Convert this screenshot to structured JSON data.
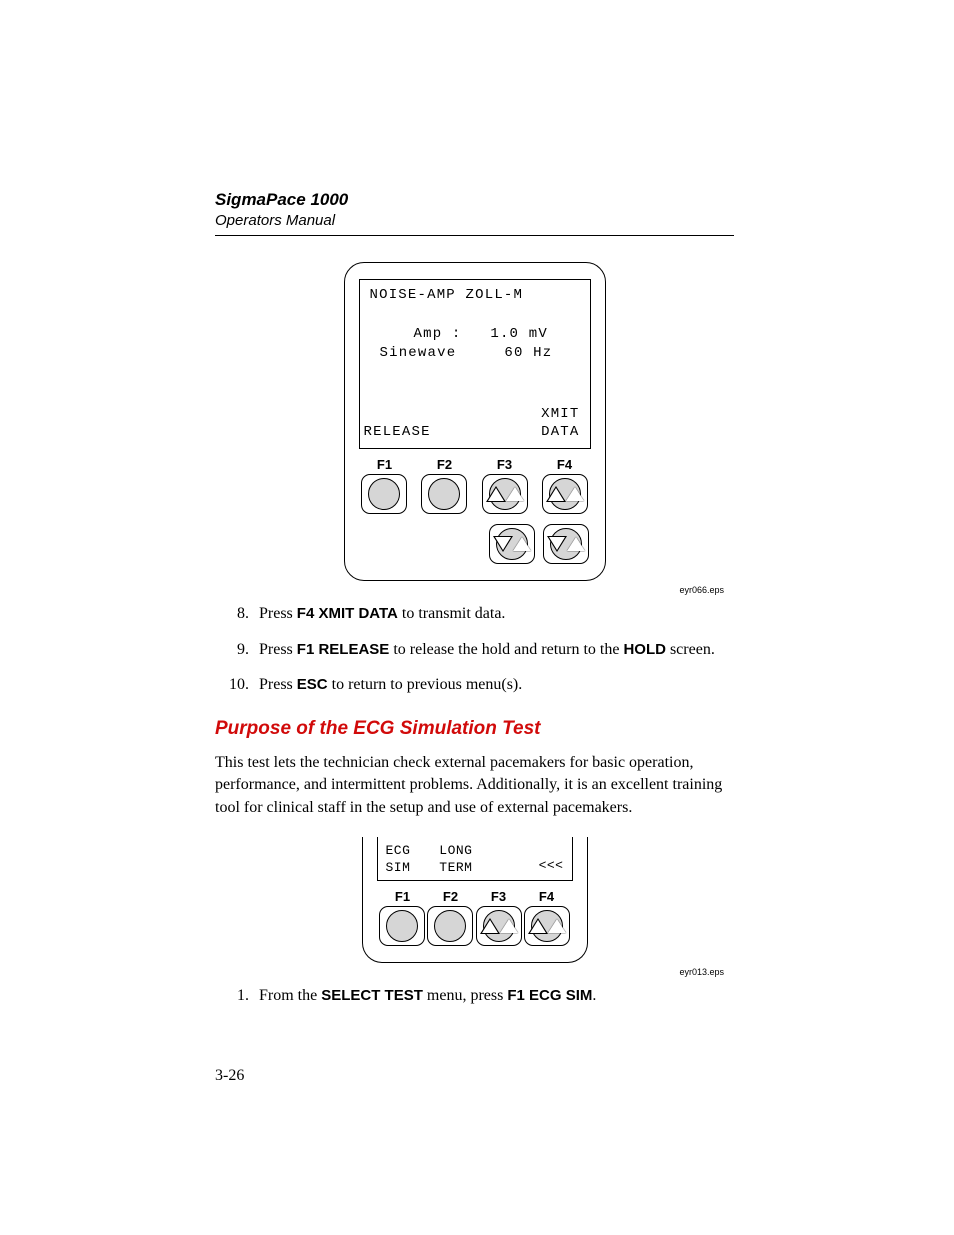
{
  "header": {
    "title": "SigmaPace 1000",
    "subtitle": "Operators Manual"
  },
  "figure1": {
    "lcd": {
      "line1": "NOISE-AMP  ZOLL-M",
      "amp_label": "Amp :",
      "amp_value": "1.0 mV",
      "sine_label": "Sinewave",
      "sine_value": "60 Hz",
      "xmit": "XMIT",
      "data": "DATA",
      "release": "RELEASE"
    },
    "fkeys": {
      "f1": "F1",
      "f2": "F2",
      "f3": "F3",
      "f4": "F4"
    },
    "caption": "eyr066.eps"
  },
  "stepsA": [
    {
      "n": "8.",
      "pre": "Press ",
      "bold": "F4 XMIT DATA",
      "post": " to transmit data."
    },
    {
      "n": "9.",
      "pre": "Press ",
      "bold": "F1 RELEASE",
      "mid": " to release the hold and return to the ",
      "bold2": "HOLD",
      "post": " screen."
    },
    {
      "n": "10.",
      "pre": "Press ",
      "bold": "ESC",
      "post": " to return to previous menu(s)."
    }
  ],
  "section": {
    "heading": "Purpose of the ECG Simulation Test",
    "para": "This test lets the technician check external pacemakers for basic operation, performance, and intermittent problems.  Additionally, it is an excellent training tool for clinical staff in the setup and use of external pacemakers."
  },
  "figure2": {
    "lcd": {
      "c1a": "ECG",
      "c1b": "SIM",
      "c2a": "LONG",
      "c2b": "TERM",
      "chev": "<<<"
    },
    "fkeys": {
      "f1": "F1",
      "f2": "F2",
      "f3": "F3",
      "f4": "F4"
    },
    "caption": "eyr013.eps"
  },
  "stepsB": [
    {
      "n": "1.",
      "pre": "From the ",
      "bold": "SELECT TEST",
      "mid": " menu, press ",
      "bold2": "F1 ECG SIM",
      "post": "."
    }
  ],
  "page_number": "3-26"
}
